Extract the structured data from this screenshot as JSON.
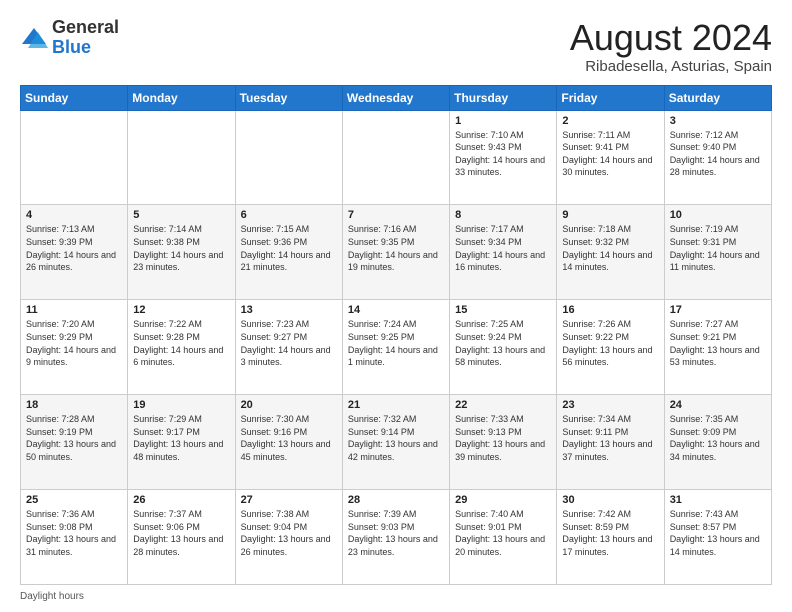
{
  "header": {
    "logo_general": "General",
    "logo_blue": "Blue",
    "month_year": "August 2024",
    "location": "Ribadesella, Asturias, Spain"
  },
  "days_of_week": [
    "Sunday",
    "Monday",
    "Tuesday",
    "Wednesday",
    "Thursday",
    "Friday",
    "Saturday"
  ],
  "weeks": [
    [
      {
        "day": "",
        "info": ""
      },
      {
        "day": "",
        "info": ""
      },
      {
        "day": "",
        "info": ""
      },
      {
        "day": "",
        "info": ""
      },
      {
        "day": "1",
        "info": "Sunrise: 7:10 AM\nSunset: 9:43 PM\nDaylight: 14 hours\nand 33 minutes."
      },
      {
        "day": "2",
        "info": "Sunrise: 7:11 AM\nSunset: 9:41 PM\nDaylight: 14 hours\nand 30 minutes."
      },
      {
        "day": "3",
        "info": "Sunrise: 7:12 AM\nSunset: 9:40 PM\nDaylight: 14 hours\nand 28 minutes."
      }
    ],
    [
      {
        "day": "4",
        "info": "Sunrise: 7:13 AM\nSunset: 9:39 PM\nDaylight: 14 hours\nand 26 minutes."
      },
      {
        "day": "5",
        "info": "Sunrise: 7:14 AM\nSunset: 9:38 PM\nDaylight: 14 hours\nand 23 minutes."
      },
      {
        "day": "6",
        "info": "Sunrise: 7:15 AM\nSunset: 9:36 PM\nDaylight: 14 hours\nand 21 minutes."
      },
      {
        "day": "7",
        "info": "Sunrise: 7:16 AM\nSunset: 9:35 PM\nDaylight: 14 hours\nand 19 minutes."
      },
      {
        "day": "8",
        "info": "Sunrise: 7:17 AM\nSunset: 9:34 PM\nDaylight: 14 hours\nand 16 minutes."
      },
      {
        "day": "9",
        "info": "Sunrise: 7:18 AM\nSunset: 9:32 PM\nDaylight: 14 hours\nand 14 minutes."
      },
      {
        "day": "10",
        "info": "Sunrise: 7:19 AM\nSunset: 9:31 PM\nDaylight: 14 hours\nand 11 minutes."
      }
    ],
    [
      {
        "day": "11",
        "info": "Sunrise: 7:20 AM\nSunset: 9:29 PM\nDaylight: 14 hours\nand 9 minutes."
      },
      {
        "day": "12",
        "info": "Sunrise: 7:22 AM\nSunset: 9:28 PM\nDaylight: 14 hours\nand 6 minutes."
      },
      {
        "day": "13",
        "info": "Sunrise: 7:23 AM\nSunset: 9:27 PM\nDaylight: 14 hours\nand 3 minutes."
      },
      {
        "day": "14",
        "info": "Sunrise: 7:24 AM\nSunset: 9:25 PM\nDaylight: 14 hours\nand 1 minute."
      },
      {
        "day": "15",
        "info": "Sunrise: 7:25 AM\nSunset: 9:24 PM\nDaylight: 13 hours\nand 58 minutes."
      },
      {
        "day": "16",
        "info": "Sunrise: 7:26 AM\nSunset: 9:22 PM\nDaylight: 13 hours\nand 56 minutes."
      },
      {
        "day": "17",
        "info": "Sunrise: 7:27 AM\nSunset: 9:21 PM\nDaylight: 13 hours\nand 53 minutes."
      }
    ],
    [
      {
        "day": "18",
        "info": "Sunrise: 7:28 AM\nSunset: 9:19 PM\nDaylight: 13 hours\nand 50 minutes."
      },
      {
        "day": "19",
        "info": "Sunrise: 7:29 AM\nSunset: 9:17 PM\nDaylight: 13 hours\nand 48 minutes."
      },
      {
        "day": "20",
        "info": "Sunrise: 7:30 AM\nSunset: 9:16 PM\nDaylight: 13 hours\nand 45 minutes."
      },
      {
        "day": "21",
        "info": "Sunrise: 7:32 AM\nSunset: 9:14 PM\nDaylight: 13 hours\nand 42 minutes."
      },
      {
        "day": "22",
        "info": "Sunrise: 7:33 AM\nSunset: 9:13 PM\nDaylight: 13 hours\nand 39 minutes."
      },
      {
        "day": "23",
        "info": "Sunrise: 7:34 AM\nSunset: 9:11 PM\nDaylight: 13 hours\nand 37 minutes."
      },
      {
        "day": "24",
        "info": "Sunrise: 7:35 AM\nSunset: 9:09 PM\nDaylight: 13 hours\nand 34 minutes."
      }
    ],
    [
      {
        "day": "25",
        "info": "Sunrise: 7:36 AM\nSunset: 9:08 PM\nDaylight: 13 hours\nand 31 minutes."
      },
      {
        "day": "26",
        "info": "Sunrise: 7:37 AM\nSunset: 9:06 PM\nDaylight: 13 hours\nand 28 minutes."
      },
      {
        "day": "27",
        "info": "Sunrise: 7:38 AM\nSunset: 9:04 PM\nDaylight: 13 hours\nand 26 minutes."
      },
      {
        "day": "28",
        "info": "Sunrise: 7:39 AM\nSunset: 9:03 PM\nDaylight: 13 hours\nand 23 minutes."
      },
      {
        "day": "29",
        "info": "Sunrise: 7:40 AM\nSunset: 9:01 PM\nDaylight: 13 hours\nand 20 minutes."
      },
      {
        "day": "30",
        "info": "Sunrise: 7:42 AM\nSunset: 8:59 PM\nDaylight: 13 hours\nand 17 minutes."
      },
      {
        "day": "31",
        "info": "Sunrise: 7:43 AM\nSunset: 8:57 PM\nDaylight: 13 hours\nand 14 minutes."
      }
    ]
  ],
  "footer": {
    "daylight_label": "Daylight hours"
  },
  "colors": {
    "header_bg": "#2277cc",
    "accent": "#2277cc"
  }
}
